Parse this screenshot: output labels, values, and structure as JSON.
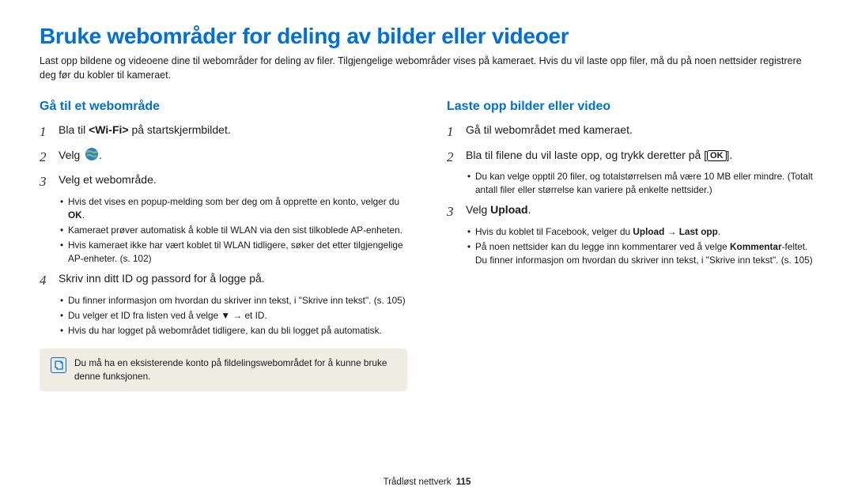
{
  "title": "Bruke webområder for deling av bilder eller videoer",
  "intro": "Last opp bildene og videoene dine til webområder for deling av filer. Tilgjengelige webområder vises på kameraet. Hvis du vil laste opp filer, må du på noen nettsider registrere deg før du kobler til kameraet.",
  "left": {
    "heading": "Gå til et webområde",
    "step1_pre": "Bla til ",
    "step1_bold": "<Wi-Fi>",
    "step1_post": " på startskjermbildet.",
    "step2_pre": "Velg ",
    "step3": "Velg et webområde.",
    "step3_sub1_pre": "Hvis det vises en popup-melding som ber deg om å opprette en konto, velger du ",
    "step3_sub1_bold": "OK",
    "step3_sub1_post": ".",
    "step3_sub2": "Kameraet prøver automatisk å koble til WLAN via den sist tilkoblede AP-enheten.",
    "step3_sub3": "Hvis kameraet ikke har vært koblet til WLAN tidligere, søker det etter tilgjengelige AP-enheter. (s. 102)",
    "step4": "Skriv inn ditt ID og passord for å logge på.",
    "step4_sub1": "Du finner informasjon om hvordan du skriver inn tekst, i \"Skrive inn tekst\". (s. 105)",
    "step4_sub2": "Du velger et ID fra listen ved å velge ▼ → et ID.",
    "step4_sub3": "Hvis du har logget på webområdet tidligere, kan du bli logget på automatisk.",
    "note": "Du må ha en eksisterende konto på fildelingswebområdet for å kunne bruke denne funksjonen."
  },
  "right": {
    "heading": "Laste opp bilder eller video",
    "step1": "Gå til webområdet med kameraet.",
    "step2_pre": "Bla til filene du vil laste opp, og trykk deretter på [",
    "step2_post": "].",
    "step2_sub1": "Du kan velge opptil 20 filer, og totalstørrelsen må være 10 MB eller mindre. (Totalt antall filer eller størrelse kan variere på enkelte nettsider.)",
    "step3_pre": "Velg ",
    "step3_bold": "Upload",
    "step3_post": ".",
    "step3_sub1_pre": "Hvis du koblet til Facebook, velger du ",
    "step3_sub1_bold1": "Upload",
    "step3_sub1_mid": " → ",
    "step3_sub1_bold2": "Last opp",
    "step3_sub1_post": ".",
    "step3_sub2_pre": "På noen nettsider kan du legge inn kommentarer ved å velge ",
    "step3_sub2_bold": "Kommentar",
    "step3_sub2_post": "-feltet. Du finner informasjon om hvordan du skriver inn tekst, i \"Skrive inn tekst\". (s. 105)"
  },
  "ok_badge": "OK",
  "footer_label": "Trådløst nettverk",
  "footer_page": "115"
}
